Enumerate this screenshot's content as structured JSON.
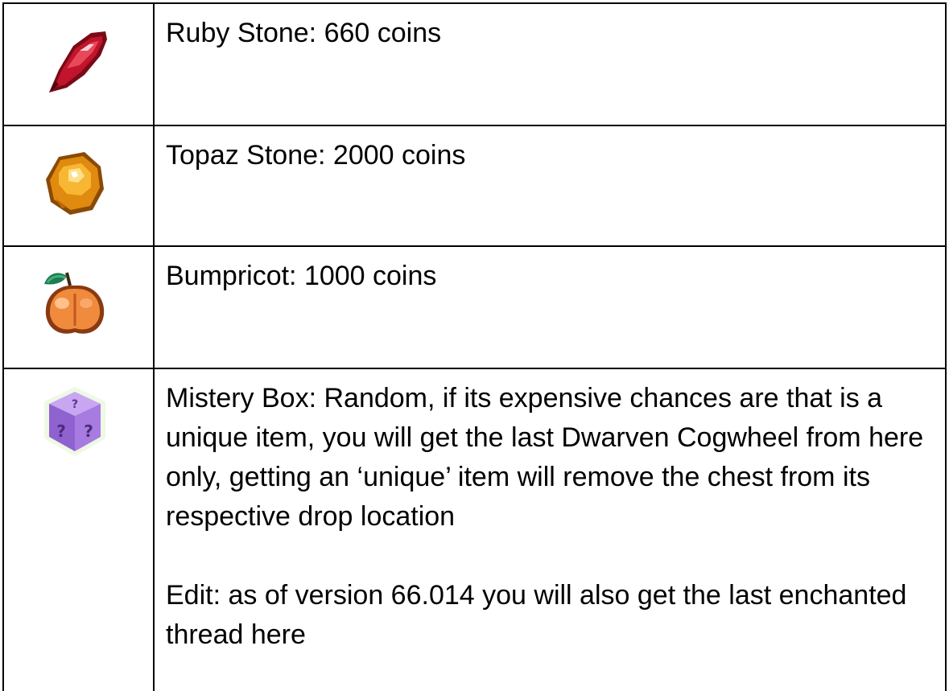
{
  "items": [
    {
      "icon": "ruby-stone-icon",
      "text": "Ruby Stone: 660 coins"
    },
    {
      "icon": "topaz-stone-icon",
      "text": "Topaz Stone: 2000 coins"
    },
    {
      "icon": "bumpricot-icon",
      "text": "Bumpricot: 1000 coins"
    },
    {
      "icon": "mystery-box-icon",
      "text": "Mistery Box: Random, if its expensive chances are that is a unique item, you will get the last Dwarven Cogwheel from here only, getting an ‘unique’ item will remove the chest from its respective drop location",
      "edit": "Edit: as of version 66.014 you will also get the last enchanted thread here"
    }
  ],
  "colors": {
    "ruby": "#c0152c",
    "topaz": "#f2a516",
    "bumpricot": "#f08a3c",
    "mystery_box": "#a77be0",
    "border": "#000000"
  }
}
